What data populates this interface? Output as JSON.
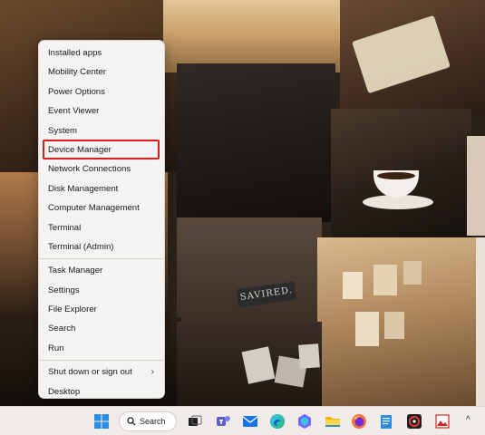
{
  "context_menu": {
    "groups": [
      [
        "Installed apps",
        "Mobility Center",
        "Power Options",
        "Event Viewer",
        "System",
        "Device Manager",
        "Network Connections",
        "Disk Management",
        "Computer Management",
        "Terminal",
        "Terminal (Admin)"
      ],
      [
        "Task Manager",
        "Settings",
        "File Explorer",
        "Search",
        "Run"
      ],
      [
        "Shut down or sign out",
        "Desktop"
      ]
    ],
    "submenu_arrow": "›",
    "highlighted_item": "Device Manager",
    "highlight_color": "#d81e1e"
  },
  "wallpaper": {
    "sign_text": "SAVIRED."
  },
  "taskbar": {
    "search_label": "Search",
    "icons": [
      "windows-start-icon",
      "search-icon",
      "task-view-icon",
      "teams-icon",
      "mail-icon",
      "edge-icon",
      "copilot-icon",
      "file-explorer-icon",
      "firefox-icon",
      "notepad-icon",
      "app-icon",
      "image-app-icon"
    ],
    "tray_chevron": "^"
  }
}
